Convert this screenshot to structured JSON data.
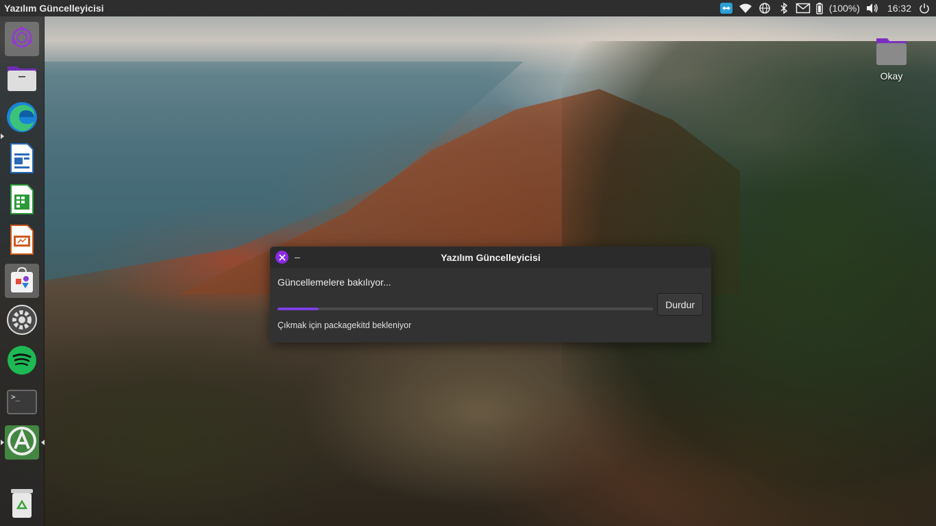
{
  "top_panel": {
    "app_title": "Yazılım Güncelleyicisi",
    "tray": {
      "battery_percent_text": "(100%)",
      "clock": "16:32",
      "icons": [
        "teamviewer-icon",
        "wifi-icon",
        "network-globe-icon",
        "bluetooth-icon",
        "mail-icon",
        "battery-icon",
        "volume-icon",
        "power-icon"
      ]
    }
  },
  "launcher": {
    "items": [
      {
        "name": "ubuntu-dash",
        "icon": "ubuntu-logo-icon"
      },
      {
        "name": "files",
        "icon": "files-folder-icon"
      },
      {
        "name": "microsoft-edge",
        "icon": "edge-icon"
      },
      {
        "name": "libreoffice-writer",
        "icon": "writer-icon"
      },
      {
        "name": "libreoffice-calc",
        "icon": "calc-icon"
      },
      {
        "name": "libreoffice-impress",
        "icon": "impress-icon"
      },
      {
        "name": "ubuntu-software",
        "icon": "software-bag-icon"
      },
      {
        "name": "settings",
        "icon": "gear-icon"
      },
      {
        "name": "spotify",
        "icon": "spotify-icon"
      },
      {
        "name": "terminal",
        "icon": "terminal-icon"
      },
      {
        "name": "software-updater",
        "icon": "updater-icon"
      },
      {
        "name": "trash",
        "icon": "trash-icon"
      }
    ],
    "terminal_prompt": ">_"
  },
  "desktop": {
    "folder_label": "Okay"
  },
  "dialog": {
    "title": "Yazılım Güncelleyicisi",
    "minimize_label": "–",
    "heading": "Güncellemelere bakılıyor...",
    "progress_fraction": 0.11,
    "stop_button_label": "Durdur",
    "detail": "Çıkmak için packagekitd bekleniyor"
  },
  "colors": {
    "accent": "#7b3fe4",
    "close_button": "#8a2be2",
    "panel_bg": "#2e2e2e",
    "dialog_bg": "#323232"
  }
}
